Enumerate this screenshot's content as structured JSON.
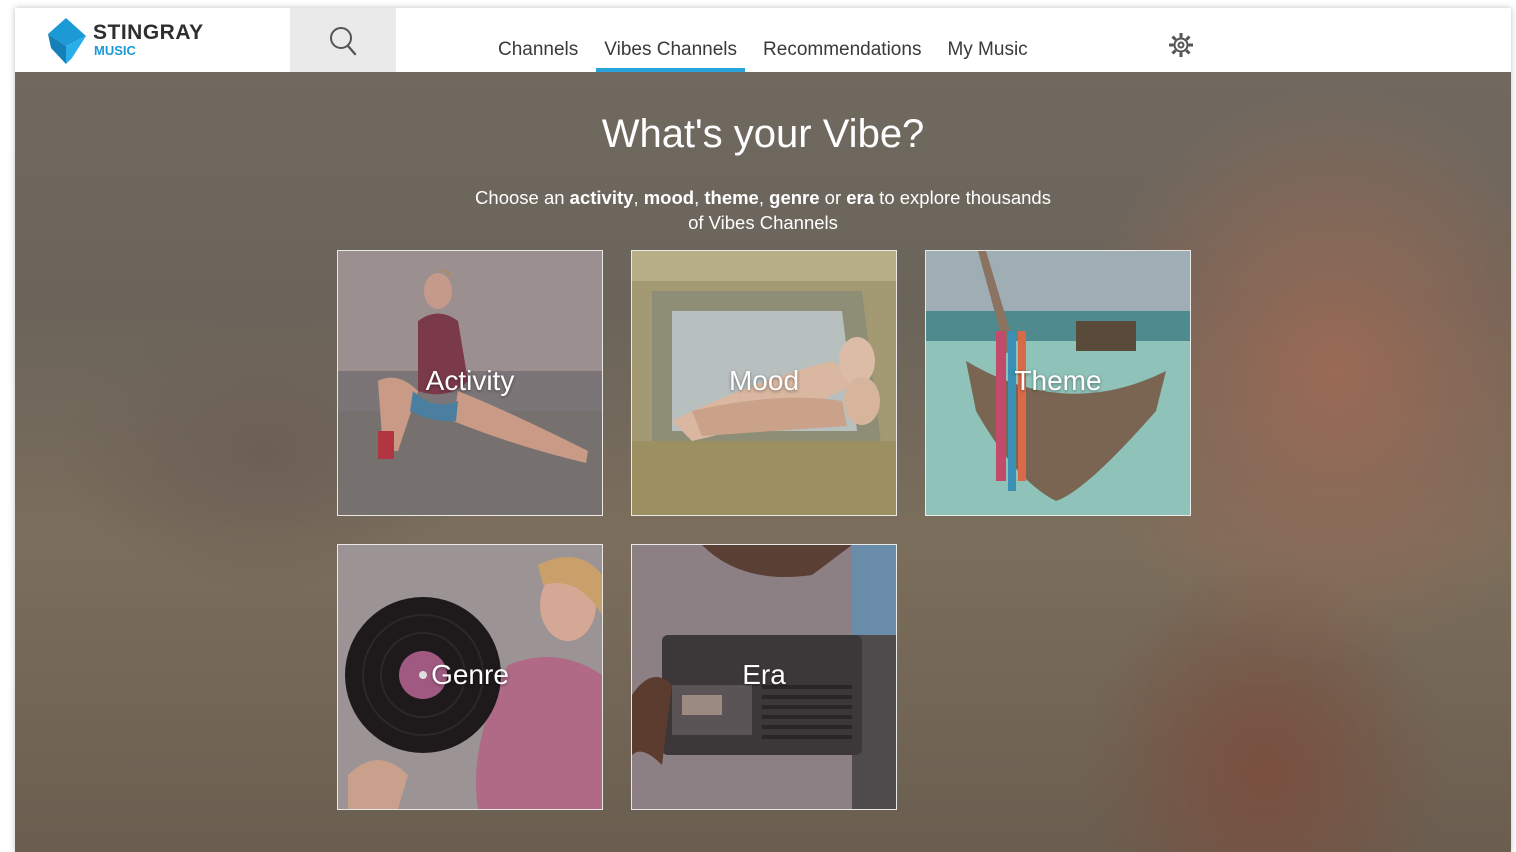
{
  "brand": {
    "name": "STINGRAY",
    "sub": "MUSIC",
    "colors": {
      "primary": "#1b9ad6",
      "dark": "#2e2e2e"
    }
  },
  "header": {
    "search_icon": "search-icon",
    "settings_icon": "gear-icon",
    "nav": [
      {
        "label": "Channels",
        "active": false
      },
      {
        "label": "Vibes Channels",
        "active": true
      },
      {
        "label": "Recommendations",
        "active": false
      },
      {
        "label": "My Music",
        "active": false
      }
    ],
    "accent_color": "#2aa3dc"
  },
  "hero": {
    "title": "What's your Vibe?",
    "subtitle": {
      "t1": "Choose an ",
      "activity": "activity",
      "comma1": ", ",
      "mood": "mood",
      "comma2": ", ",
      "theme": "theme",
      "comma3": ", ",
      "genre": "genre",
      "or": " or ",
      "era": "era",
      "t2": " to explore thousands of Vibes Channels"
    }
  },
  "tiles": [
    {
      "label": "Activity"
    },
    {
      "label": "Mood"
    },
    {
      "label": "Theme"
    },
    {
      "label": "Genre"
    },
    {
      "label": "Era"
    }
  ]
}
